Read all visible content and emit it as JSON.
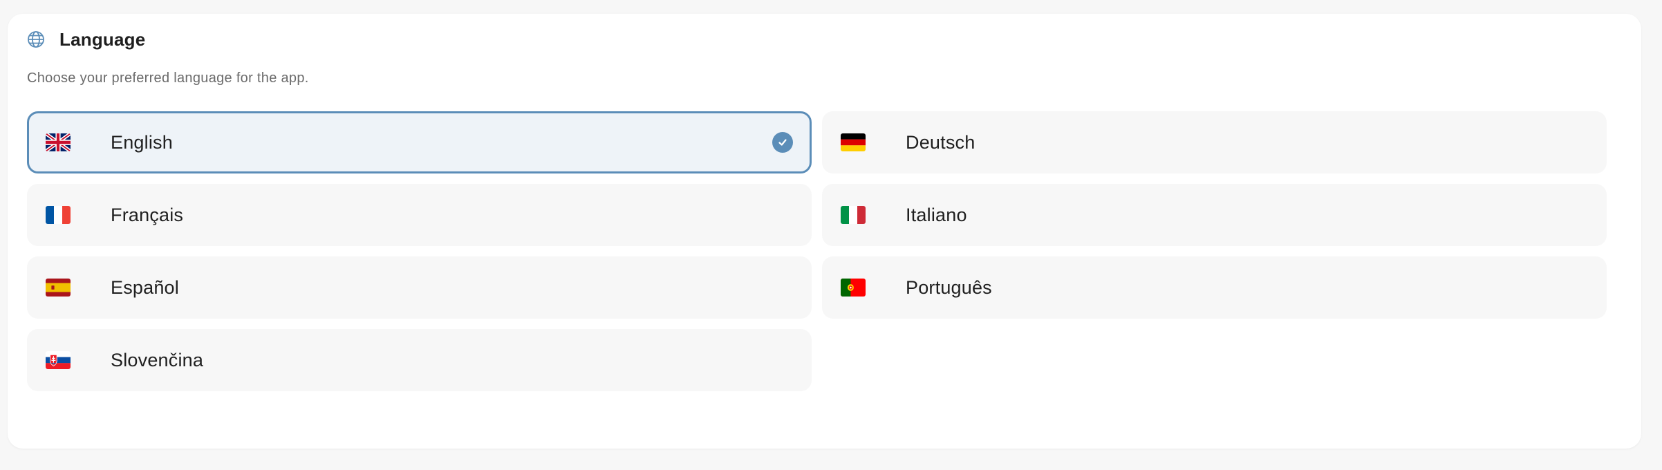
{
  "section": {
    "title": "Language",
    "subtitle": "Choose your preferred language for the app.",
    "icon": "globe-icon"
  },
  "options": [
    {
      "label": "English",
      "flag": "gb-flag-icon",
      "selected": true
    },
    {
      "label": "Deutsch",
      "flag": "de-flag-icon",
      "selected": false
    },
    {
      "label": "Français",
      "flag": "fr-flag-icon",
      "selected": false
    },
    {
      "label": "Italiano",
      "flag": "it-flag-icon",
      "selected": false
    },
    {
      "label": "Español",
      "flag": "es-flag-icon",
      "selected": false
    },
    {
      "label": "Português",
      "flag": "pt-flag-icon",
      "selected": false
    },
    {
      "label": "Slovenčina",
      "flag": "sk-flag-icon",
      "selected": false
    }
  ],
  "colors": {
    "accent": "#5b8db8",
    "selected_background": "#eef3f8",
    "option_background": "#f7f7f7"
  }
}
